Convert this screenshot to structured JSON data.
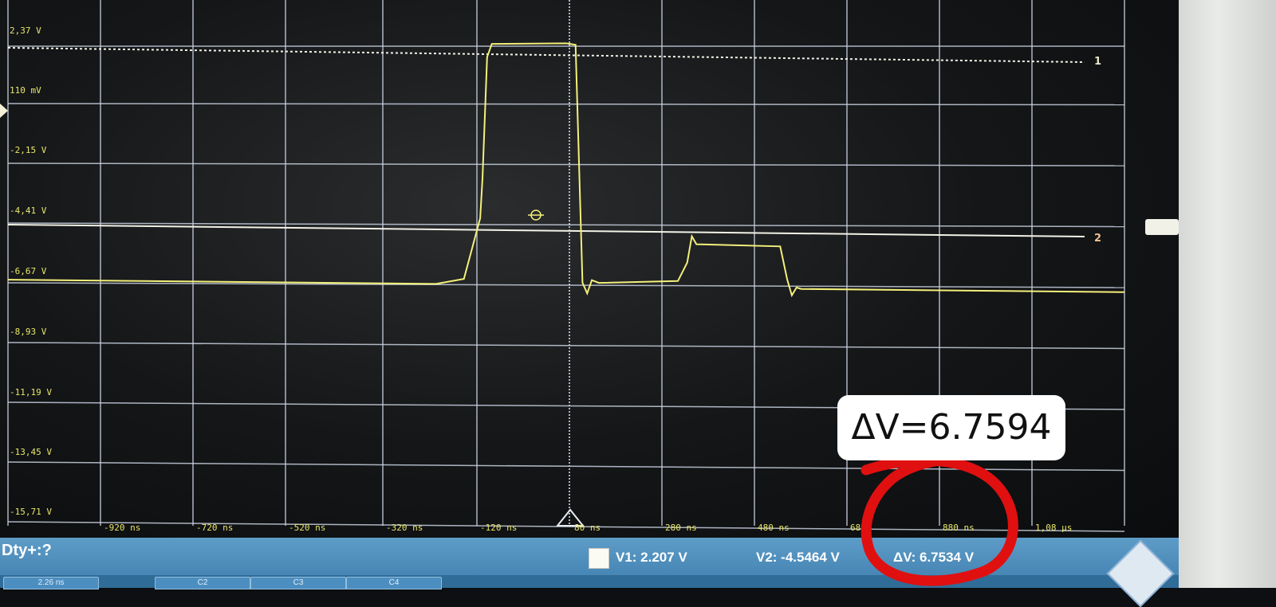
{
  "scope": {
    "y_labels": [
      "2,37 V",
      "110 mV",
      "-2,15 V",
      "-4,41 V",
      "-6,67 V",
      "-8,93 V",
      "-11,19 V",
      "-13,45 V",
      "-15,71 V"
    ],
    "x_labels": [
      "-920 ns",
      "-720 ns",
      "-520 ns",
      "-320 ns",
      "-120 ns",
      "80 ns",
      "280 ns",
      "480 ns",
      "680",
      "880 ns",
      "1,08 µs"
    ],
    "marker_1": "1",
    "marker_2": "2",
    "trace_color": "#f4f07a",
    "grid_color": "#c9d2e0"
  },
  "chart_data": {
    "type": "line",
    "xlim": [
      -1120,
      1280
    ],
    "ylim": [
      -15.71,
      2.37
    ],
    "series": [
      {
        "x": [
          -1120,
          -200,
          -140,
          -105,
          -100,
          -90,
          -80,
          80,
          100,
          115,
          125,
          135,
          150,
          320,
          340,
          350,
          360,
          540,
          555,
          565,
          575,
          585,
          1280
        ],
        "y": [
          -7.0,
          -7.0,
          -6.8,
          -4.5,
          -3.0,
          1.6,
          2.1,
          2.15,
          2.1,
          -6.9,
          -7.3,
          -6.8,
          -6.9,
          -6.8,
          -6.1,
          -5.1,
          -5.4,
          -5.45,
          -6.7,
          -7.3,
          -7.0,
          -7.05,
          -7.05
        ]
      }
    ]
  },
  "callout_text": "ΔV=6.7594",
  "bottom_bar": {
    "dty": "Dty+:?",
    "v1": "V1: 2.207 V",
    "v2": "V2: -4.5464 V",
    "dv": "ΔV: 6.7534 V",
    "lower_buttons": [
      "2.26 ns",
      "C2",
      "C3",
      "C4"
    ]
  },
  "annotation_color": "#e01010"
}
